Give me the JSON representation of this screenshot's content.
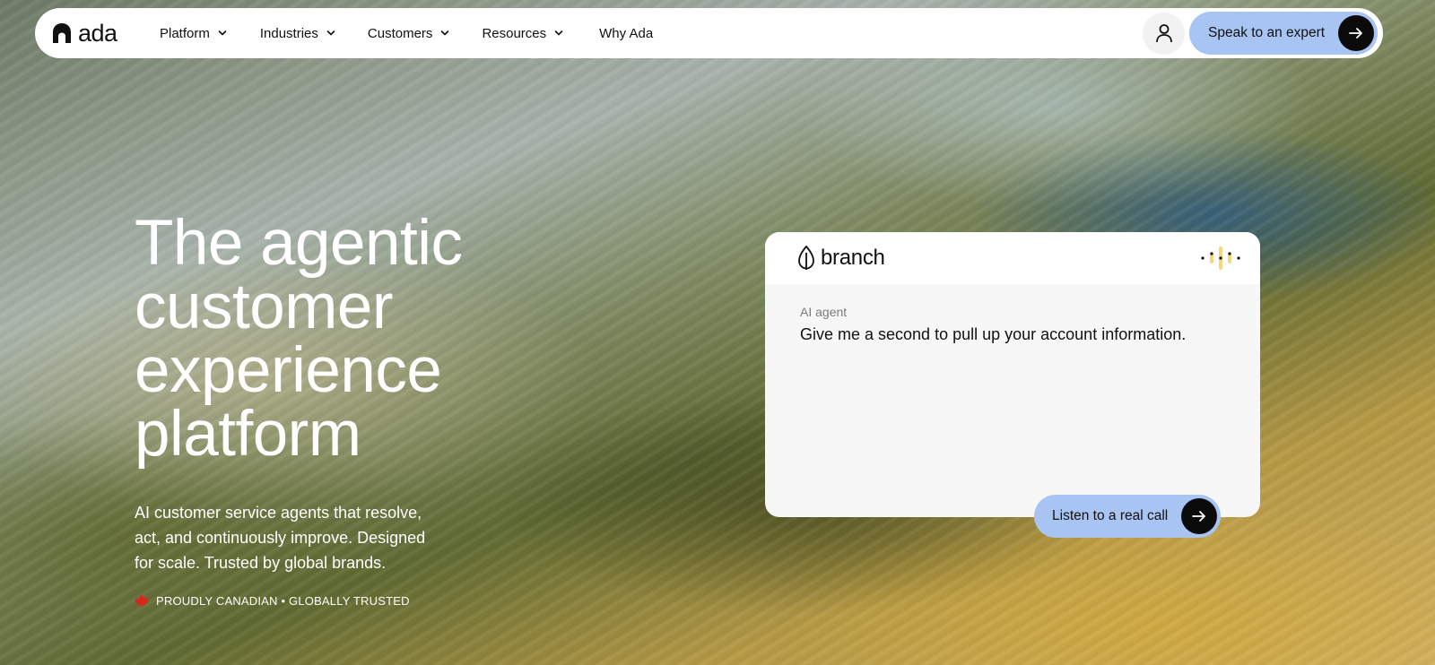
{
  "brand": {
    "name": "ada"
  },
  "nav": {
    "items": [
      {
        "label": "Platform",
        "has_dropdown": true
      },
      {
        "label": "Industries",
        "has_dropdown": true
      },
      {
        "label": "Customers",
        "has_dropdown": true
      },
      {
        "label": "Resources",
        "has_dropdown": true
      },
      {
        "label": "Why Ada",
        "has_dropdown": false
      }
    ],
    "account_icon": "user-icon",
    "cta_label": "Speak to an expert",
    "cta_icon": "arrow-right-icon"
  },
  "hero": {
    "title_lines": [
      "The agentic",
      "customer",
      "experience",
      "platform"
    ],
    "subtitle": "AI customer service agents that resolve, act, and continuously improve. Designed for scale. Trusted by global brands.",
    "badge_icon": "maple-leaf-icon",
    "badge_text": "PROUDLY CANADIAN • GLOBALLY TRUSTED"
  },
  "demo_card": {
    "company": "branch",
    "company_icon": "leaf-icon",
    "status_icon": "voice-wave-icon",
    "speaker": "AI agent",
    "message": "Give me a second to pull up your account information.",
    "button_label": "Listen to a real call",
    "button_icon": "arrow-right-icon"
  },
  "colors": {
    "accent": "#a8c4f3",
    "dark": "#0b0b0b",
    "card_bg": "#f7f7f7",
    "wave_yellow": "#f5d77a",
    "maple_red": "#d9261c"
  }
}
